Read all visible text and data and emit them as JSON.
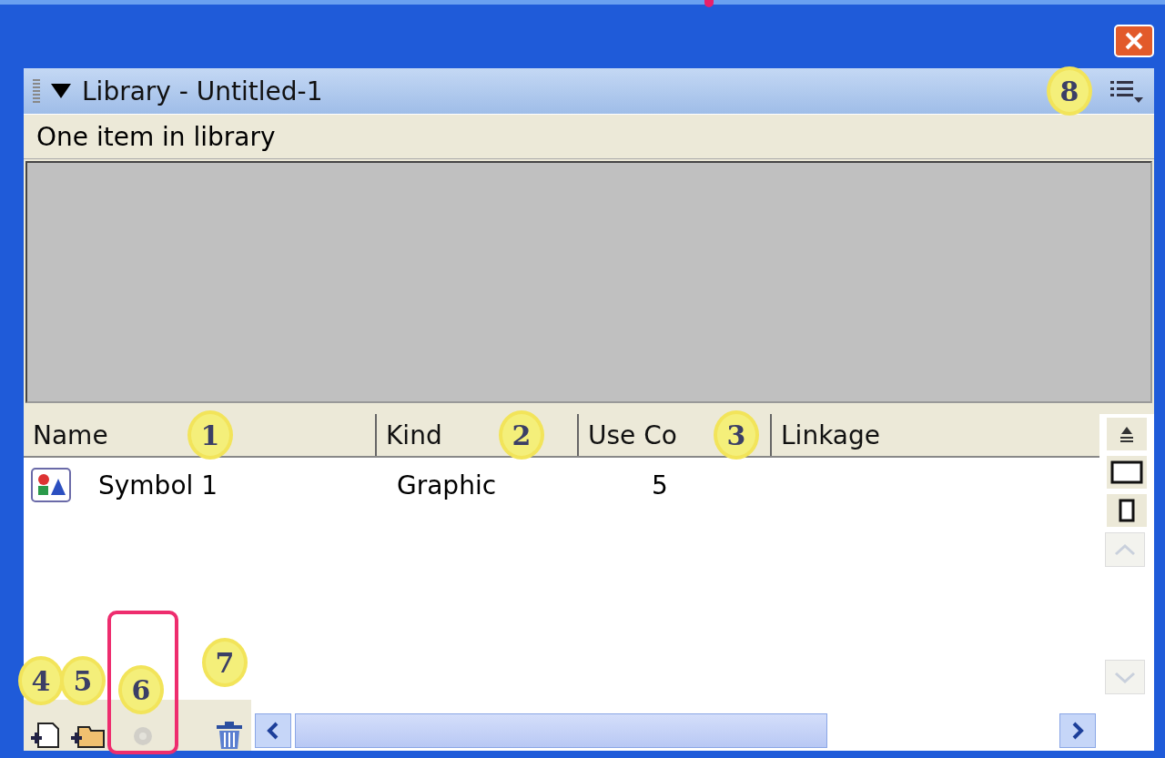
{
  "panel": {
    "title": "Library - Untitled-1",
    "expanded": true,
    "callout": "8"
  },
  "status": "One item in library",
  "columns": [
    {
      "label": "Name",
      "callout": "1"
    },
    {
      "label": "Kind",
      "callout": "2"
    },
    {
      "label": "Use Co",
      "callout": "3"
    },
    {
      "label": "Linkage"
    }
  ],
  "rows": [
    {
      "cells": [
        "Symbol 1",
        "Graphic",
        "5"
      ],
      "selected": false
    }
  ],
  "toolbar": [
    {
      "kind": "new-symbol",
      "callout": "4",
      "disabled": false,
      "highlighted": false
    },
    {
      "kind": "new-folder",
      "callout": "5",
      "disabled": false,
      "highlighted": false
    },
    {
      "kind": "properties",
      "callout": "6",
      "disabled": true,
      "highlighted": true
    },
    {
      "kind": "delete",
      "callout": "7",
      "disabled": false,
      "highlighted": false
    }
  ]
}
